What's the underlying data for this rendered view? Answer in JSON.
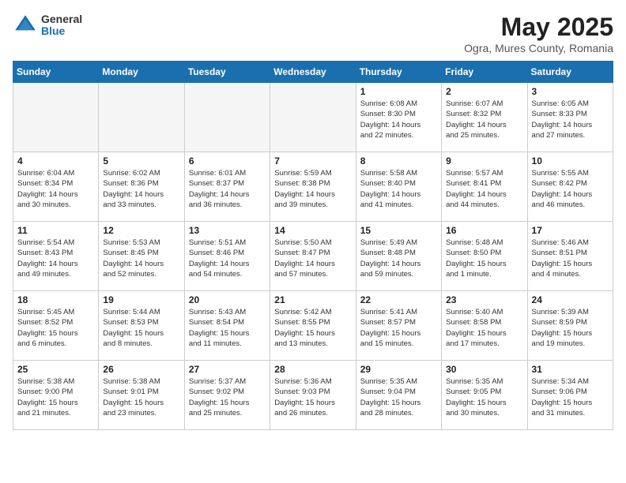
{
  "header": {
    "logo_general": "General",
    "logo_blue": "Blue",
    "title": "May 2025",
    "location": "Ogra, Mures County, Romania"
  },
  "calendar": {
    "headers": [
      "Sunday",
      "Monday",
      "Tuesday",
      "Wednesday",
      "Thursday",
      "Friday",
      "Saturday"
    ],
    "weeks": [
      [
        {
          "day": "",
          "info": ""
        },
        {
          "day": "",
          "info": ""
        },
        {
          "day": "",
          "info": ""
        },
        {
          "day": "",
          "info": ""
        },
        {
          "day": "1",
          "info": "Sunrise: 6:08 AM\nSunset: 8:30 PM\nDaylight: 14 hours\nand 22 minutes."
        },
        {
          "day": "2",
          "info": "Sunrise: 6:07 AM\nSunset: 8:32 PM\nDaylight: 14 hours\nand 25 minutes."
        },
        {
          "day": "3",
          "info": "Sunrise: 6:05 AM\nSunset: 8:33 PM\nDaylight: 14 hours\nand 27 minutes."
        }
      ],
      [
        {
          "day": "4",
          "info": "Sunrise: 6:04 AM\nSunset: 8:34 PM\nDaylight: 14 hours\nand 30 minutes."
        },
        {
          "day": "5",
          "info": "Sunrise: 6:02 AM\nSunset: 8:36 PM\nDaylight: 14 hours\nand 33 minutes."
        },
        {
          "day": "6",
          "info": "Sunrise: 6:01 AM\nSunset: 8:37 PM\nDaylight: 14 hours\nand 36 minutes."
        },
        {
          "day": "7",
          "info": "Sunrise: 5:59 AM\nSunset: 8:38 PM\nDaylight: 14 hours\nand 39 minutes."
        },
        {
          "day": "8",
          "info": "Sunrise: 5:58 AM\nSunset: 8:40 PM\nDaylight: 14 hours\nand 41 minutes."
        },
        {
          "day": "9",
          "info": "Sunrise: 5:57 AM\nSunset: 8:41 PM\nDaylight: 14 hours\nand 44 minutes."
        },
        {
          "day": "10",
          "info": "Sunrise: 5:55 AM\nSunset: 8:42 PM\nDaylight: 14 hours\nand 46 minutes."
        }
      ],
      [
        {
          "day": "11",
          "info": "Sunrise: 5:54 AM\nSunset: 8:43 PM\nDaylight: 14 hours\nand 49 minutes."
        },
        {
          "day": "12",
          "info": "Sunrise: 5:53 AM\nSunset: 8:45 PM\nDaylight: 14 hours\nand 52 minutes."
        },
        {
          "day": "13",
          "info": "Sunrise: 5:51 AM\nSunset: 8:46 PM\nDaylight: 14 hours\nand 54 minutes."
        },
        {
          "day": "14",
          "info": "Sunrise: 5:50 AM\nSunset: 8:47 PM\nDaylight: 14 hours\nand 57 minutes."
        },
        {
          "day": "15",
          "info": "Sunrise: 5:49 AM\nSunset: 8:48 PM\nDaylight: 14 hours\nand 59 minutes."
        },
        {
          "day": "16",
          "info": "Sunrise: 5:48 AM\nSunset: 8:50 PM\nDaylight: 15 hours\nand 1 minute."
        },
        {
          "day": "17",
          "info": "Sunrise: 5:46 AM\nSunset: 8:51 PM\nDaylight: 15 hours\nand 4 minutes."
        }
      ],
      [
        {
          "day": "18",
          "info": "Sunrise: 5:45 AM\nSunset: 8:52 PM\nDaylight: 15 hours\nand 6 minutes."
        },
        {
          "day": "19",
          "info": "Sunrise: 5:44 AM\nSunset: 8:53 PM\nDaylight: 15 hours\nand 8 minutes."
        },
        {
          "day": "20",
          "info": "Sunrise: 5:43 AM\nSunset: 8:54 PM\nDaylight: 15 hours\nand 11 minutes."
        },
        {
          "day": "21",
          "info": "Sunrise: 5:42 AM\nSunset: 8:55 PM\nDaylight: 15 hours\nand 13 minutes."
        },
        {
          "day": "22",
          "info": "Sunrise: 5:41 AM\nSunset: 8:57 PM\nDaylight: 15 hours\nand 15 minutes."
        },
        {
          "day": "23",
          "info": "Sunrise: 5:40 AM\nSunset: 8:58 PM\nDaylight: 15 hours\nand 17 minutes."
        },
        {
          "day": "24",
          "info": "Sunrise: 5:39 AM\nSunset: 8:59 PM\nDaylight: 15 hours\nand 19 minutes."
        }
      ],
      [
        {
          "day": "25",
          "info": "Sunrise: 5:38 AM\nSunset: 9:00 PM\nDaylight: 15 hours\nand 21 minutes."
        },
        {
          "day": "26",
          "info": "Sunrise: 5:38 AM\nSunset: 9:01 PM\nDaylight: 15 hours\nand 23 minutes."
        },
        {
          "day": "27",
          "info": "Sunrise: 5:37 AM\nSunset: 9:02 PM\nDaylight: 15 hours\nand 25 minutes."
        },
        {
          "day": "28",
          "info": "Sunrise: 5:36 AM\nSunset: 9:03 PM\nDaylight: 15 hours\nand 26 minutes."
        },
        {
          "day": "29",
          "info": "Sunrise: 5:35 AM\nSunset: 9:04 PM\nDaylight: 15 hours\nand 28 minutes."
        },
        {
          "day": "30",
          "info": "Sunrise: 5:35 AM\nSunset: 9:05 PM\nDaylight: 15 hours\nand 30 minutes."
        },
        {
          "day": "31",
          "info": "Sunrise: 5:34 AM\nSunset: 9:06 PM\nDaylight: 15 hours\nand 31 minutes."
        }
      ]
    ]
  }
}
